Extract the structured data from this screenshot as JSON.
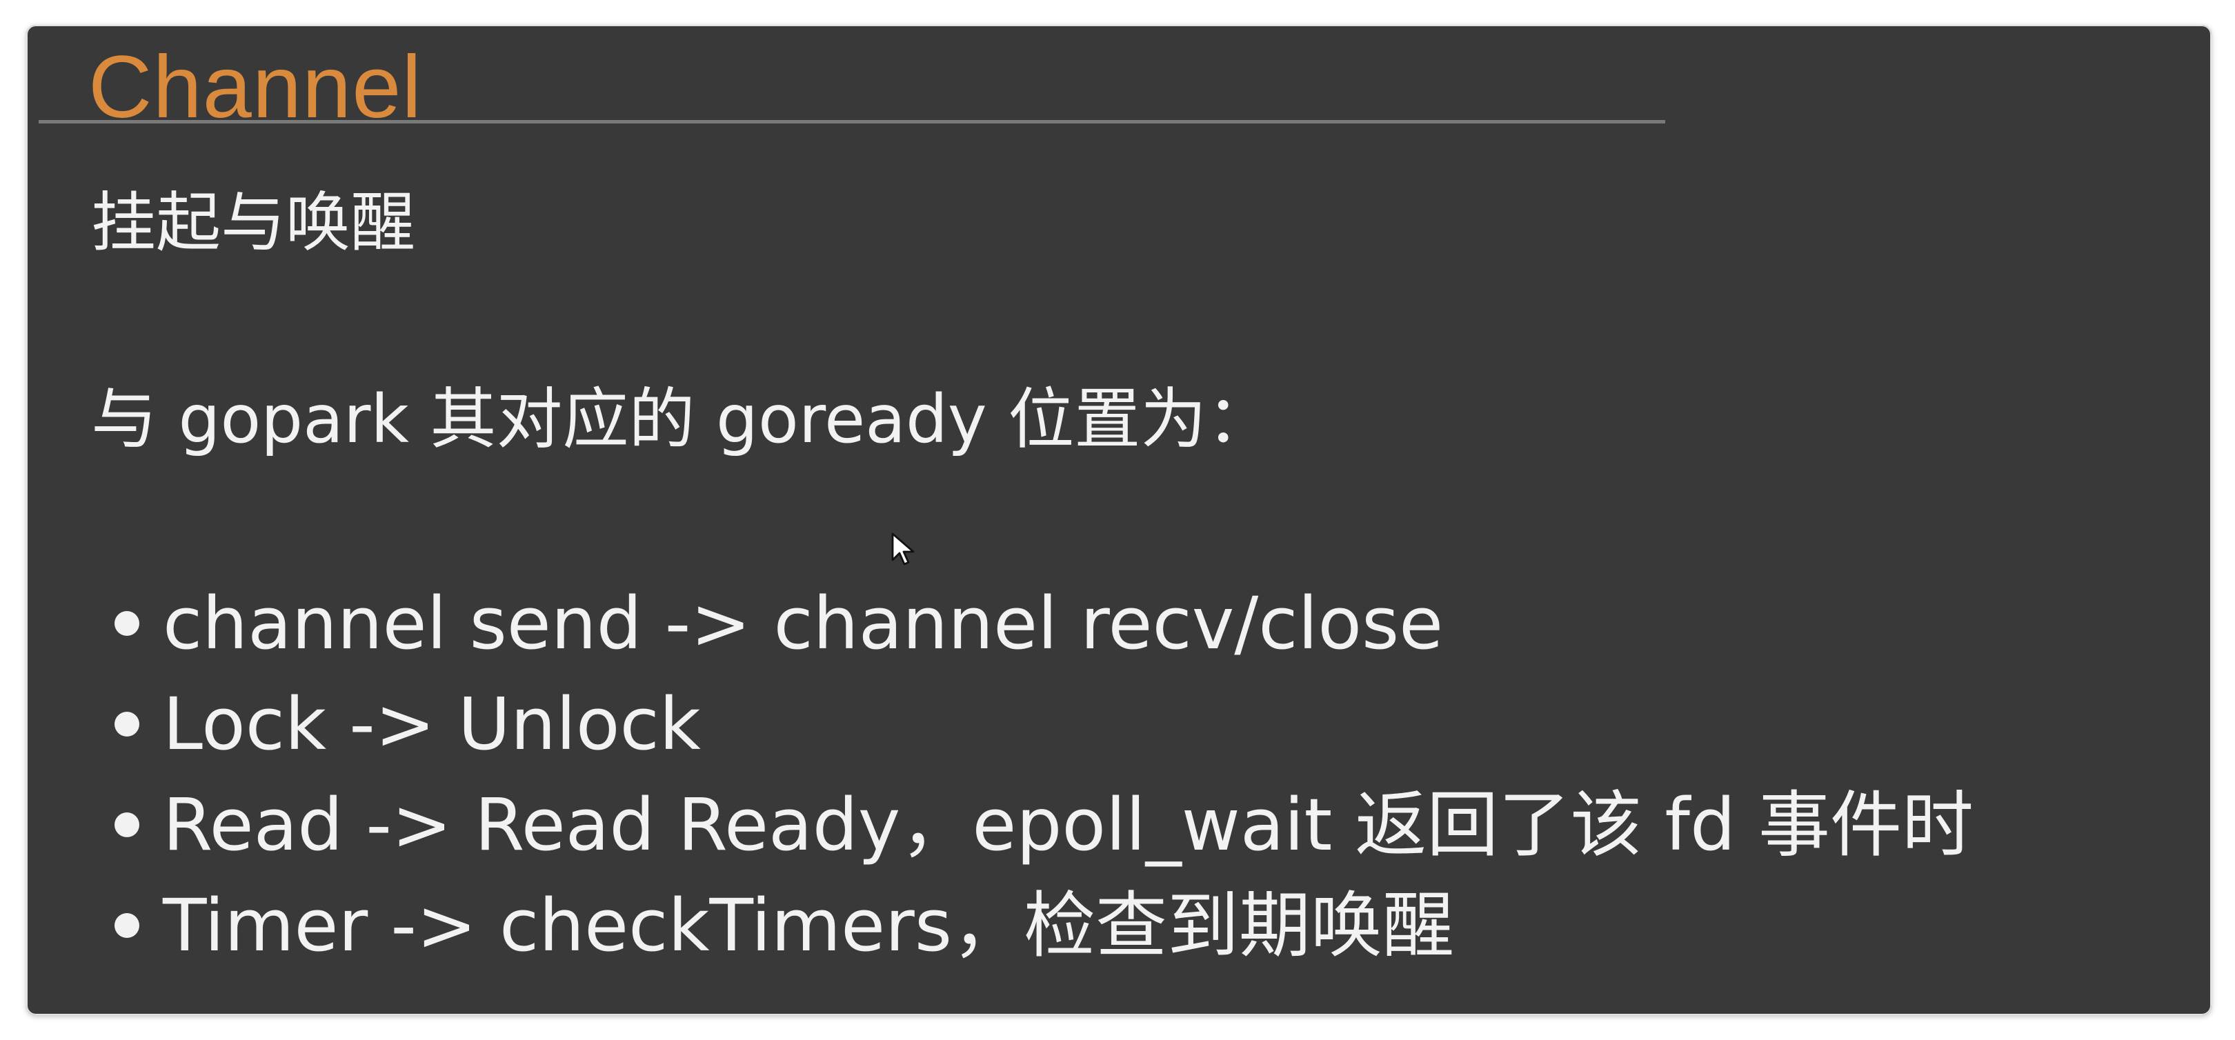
{
  "slide": {
    "title": "Channel",
    "subtitle": "挂起与唤醒",
    "intro": "与 gopark 其对应的 goready 位置为：",
    "bullets": [
      {
        "text": "channel send -> channel recv/close"
      },
      {
        "text": "Lock -> Unlock"
      },
      {
        "text": "Read -> Read Ready，epoll_wait 返回了该 fd 事件时"
      },
      {
        "text": "Timer -> checkTimers，检查到期唤醒"
      }
    ]
  },
  "colors": {
    "background": "#393939",
    "title": "#d98a3c",
    "text": "#f2f2f2",
    "rule": "#7a7a7a"
  },
  "icons": {
    "cursor": "mouse-pointer-icon"
  }
}
